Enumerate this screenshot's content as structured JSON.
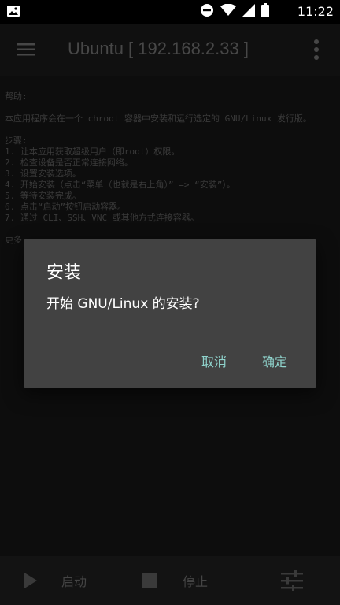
{
  "status": {
    "time": "11:22"
  },
  "appbar": {
    "title": "Ubuntu  [ 192.168.2.33 ]"
  },
  "log": {
    "help_heading": "帮助:",
    "intro": "本应用程序会在一个 chroot 容器中安装和运行选定的 GNU/Linux 发行版。",
    "steps_heading": "步骤:",
    "steps": [
      "1. 让本应用获取超级用户（即root）权限。",
      "2. 检查设备是否正常连接网络。",
      "3. 设置安装选项。",
      "4. 开始安装（点击“菜单（也就是右上角）” => “安装”）。",
      "5. 等待安装完成。",
      "6. 点击“启动”按钮启动容器。",
      "7. 通过 CLI、SSH、VNC 或其他方式连接容器。"
    ],
    "more": "更多"
  },
  "dialog": {
    "title": "安装",
    "message": "开始 GNU/Linux 的安装?",
    "cancel_label": "取消",
    "ok_label": "确定"
  },
  "bottombar": {
    "start_label": "启动",
    "stop_label": "停止"
  },
  "colors": {
    "dialog_bg": "#424242",
    "accent": "#8fd3cc",
    "appbar_bg": "#1a1a1a"
  }
}
